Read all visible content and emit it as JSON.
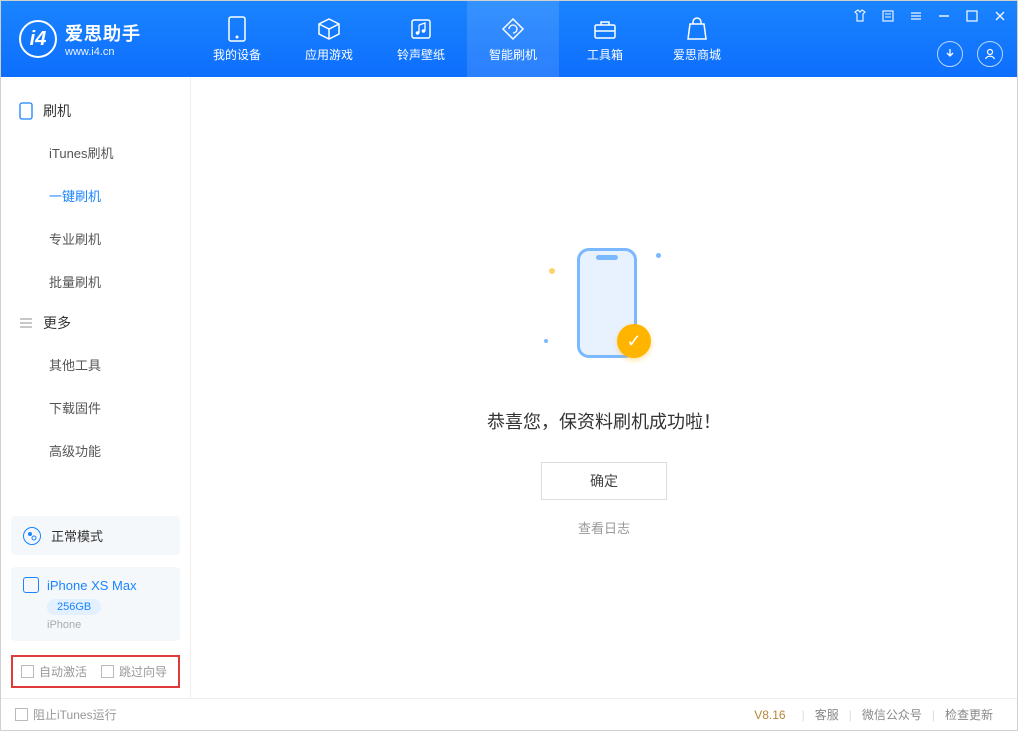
{
  "app": {
    "title": "爱思助手",
    "subtitle": "www.i4.cn"
  },
  "nav": {
    "items": [
      {
        "label": "我的设备"
      },
      {
        "label": "应用游戏"
      },
      {
        "label": "铃声壁纸"
      },
      {
        "label": "智能刷机"
      },
      {
        "label": "工具箱"
      },
      {
        "label": "爱思商城"
      }
    ]
  },
  "sidebar": {
    "section1": "刷机",
    "items1": [
      "iTunes刷机",
      "一键刷机",
      "专业刷机",
      "批量刷机"
    ],
    "section2": "更多",
    "items2": [
      "其他工具",
      "下载固件",
      "高级功能"
    ]
  },
  "mode": {
    "label": "正常模式"
  },
  "device": {
    "name": "iPhone XS Max",
    "capacity": "256GB",
    "type": "iPhone"
  },
  "options": {
    "auto_activate": "自动激活",
    "skip_guide": "跳过向导"
  },
  "main": {
    "success": "恭喜您，保资料刷机成功啦！",
    "ok": "确定",
    "view_log": "查看日志"
  },
  "footer": {
    "block_itunes": "阻止iTunes运行",
    "version": "V8.16",
    "links": [
      "客服",
      "微信公众号",
      "检查更新"
    ]
  }
}
